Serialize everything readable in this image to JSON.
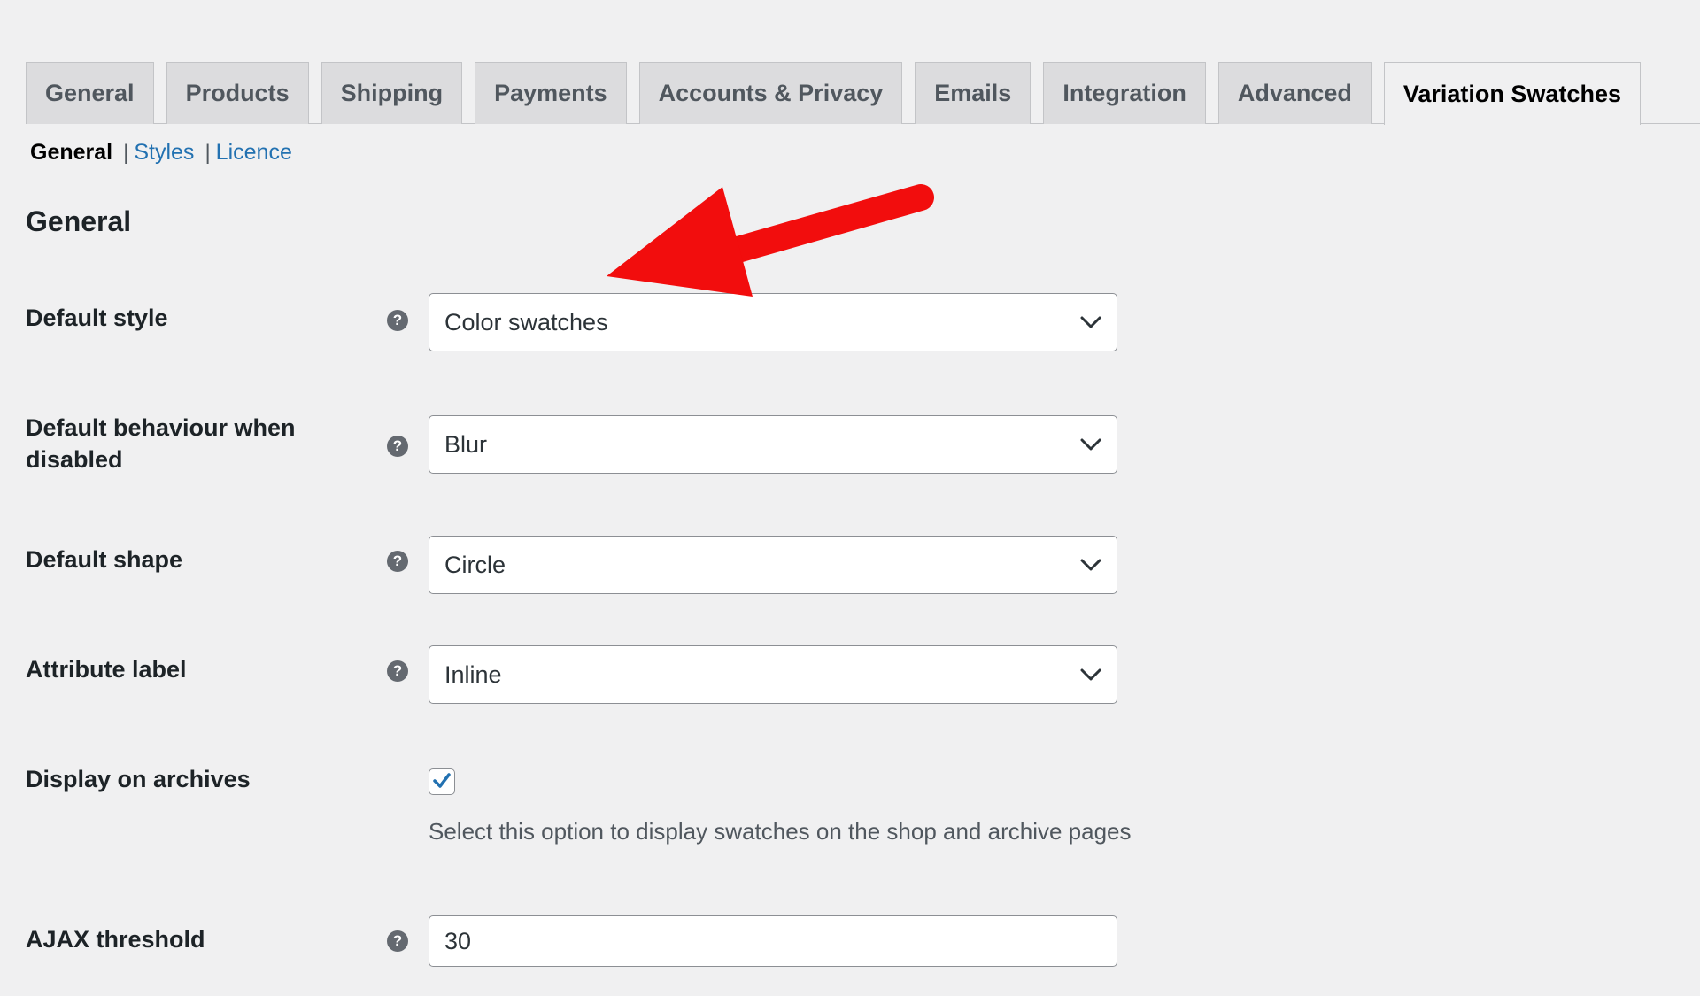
{
  "tabs": [
    {
      "label": "General",
      "active": false
    },
    {
      "label": "Products",
      "active": false
    },
    {
      "label": "Shipping",
      "active": false
    },
    {
      "label": "Payments",
      "active": false
    },
    {
      "label": "Accounts & Privacy",
      "active": false
    },
    {
      "label": "Emails",
      "active": false
    },
    {
      "label": "Integration",
      "active": false
    },
    {
      "label": "Advanced",
      "active": false
    },
    {
      "label": "Variation Swatches",
      "active": true
    }
  ],
  "subnav": {
    "current": "General",
    "separator": "|",
    "styles_link": "Styles",
    "licence_link": "Licence"
  },
  "section": {
    "title": "General"
  },
  "fields": {
    "default_style": {
      "label": "Default style",
      "value": "Color swatches"
    },
    "default_behaviour": {
      "label": "Default behaviour when disabled",
      "value": "Blur"
    },
    "default_shape": {
      "label": "Default shape",
      "value": "Circle"
    },
    "attribute_label": {
      "label": "Attribute label",
      "value": "Inline"
    },
    "display_on_archives": {
      "label": "Display on archives",
      "checked": true,
      "description": "Select this option to display swatches on the shop and archive pages"
    },
    "ajax_threshold": {
      "label": "AJAX threshold",
      "value": "30"
    }
  },
  "help_icon_glyph": "?",
  "colors": {
    "accent": "#2271b1",
    "annotation_arrow": "#f20d0d",
    "background": "#f0f0f1"
  },
  "icons": {
    "help": "question-circle-icon",
    "dropdown": "chevron-down-icon",
    "check": "checkmark-icon",
    "annotation": "red-arrow-annotation"
  }
}
